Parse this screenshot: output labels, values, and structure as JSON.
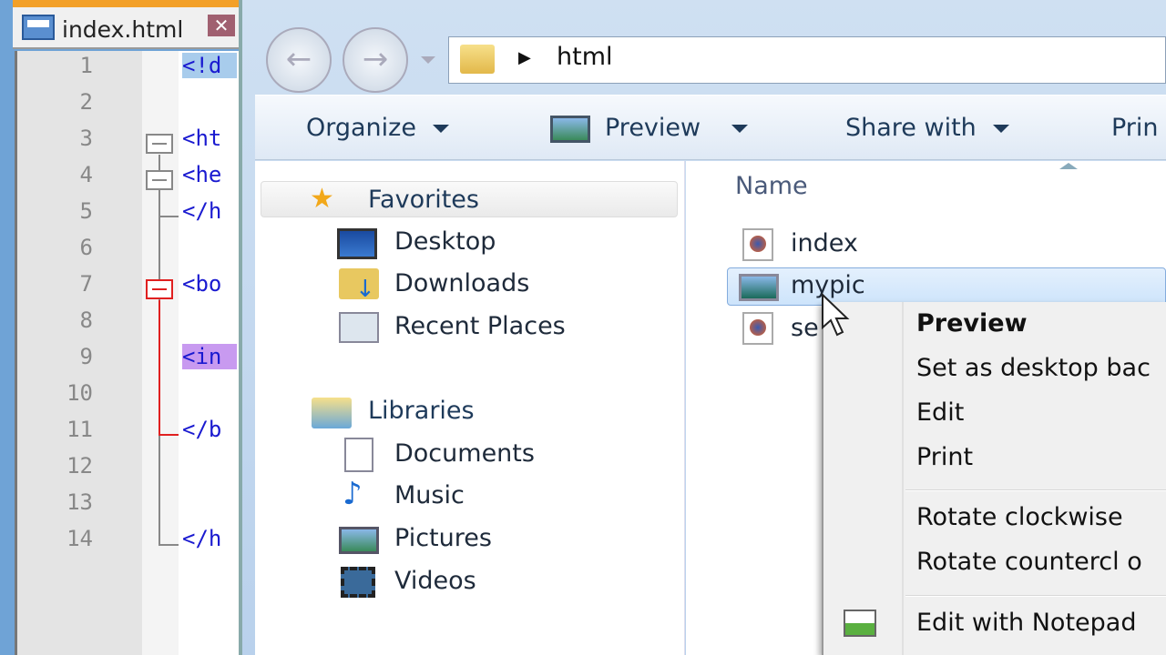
{
  "editor": {
    "tab_title": "index.html",
    "close_label": "✕",
    "lines": [
      {
        "n": "1",
        "code": "<!d"
      },
      {
        "n": "2",
        "code": ""
      },
      {
        "n": "3",
        "code": "<ht"
      },
      {
        "n": "4",
        "code": "<he"
      },
      {
        "n": "5",
        "code": "</h"
      },
      {
        "n": "6",
        "code": ""
      },
      {
        "n": "7",
        "code": "<bo"
      },
      {
        "n": "8",
        "code": ""
      },
      {
        "n": "9",
        "code": "<in"
      },
      {
        "n": "10",
        "code": ""
      },
      {
        "n": "11",
        "code": "</b"
      },
      {
        "n": "12",
        "code": ""
      },
      {
        "n": "13",
        "code": ""
      },
      {
        "n": "14",
        "code": "</h"
      }
    ]
  },
  "explorer": {
    "address": {
      "path": "html",
      "separator": "▶"
    },
    "toolbar": {
      "organize": "Organize",
      "preview": "Preview",
      "share": "Share with",
      "print": "Prin"
    },
    "nav": {
      "favorites": "Favorites",
      "desktop": "Desktop",
      "downloads": "Downloads",
      "recent": "Recent Places",
      "libraries": "Libraries",
      "documents": "Documents",
      "music": "Music",
      "pictures": "Pictures",
      "videos": "Videos"
    },
    "column_name": "Name",
    "files": [
      {
        "name": "index",
        "type": "html"
      },
      {
        "name": "mypic",
        "type": "image",
        "selected": true
      },
      {
        "name": "se",
        "type": "html"
      }
    ]
  },
  "context_menu": {
    "items": [
      "Preview",
      "Set as desktop bac",
      "Edit",
      "Print",
      "Rotate clockwise",
      "Rotate countercl o",
      "Edit with Notepad"
    ]
  },
  "colors": {
    "selection": "#cde4fb",
    "code_blue": "#1a1ad0",
    "fold_red": "#e02020"
  }
}
